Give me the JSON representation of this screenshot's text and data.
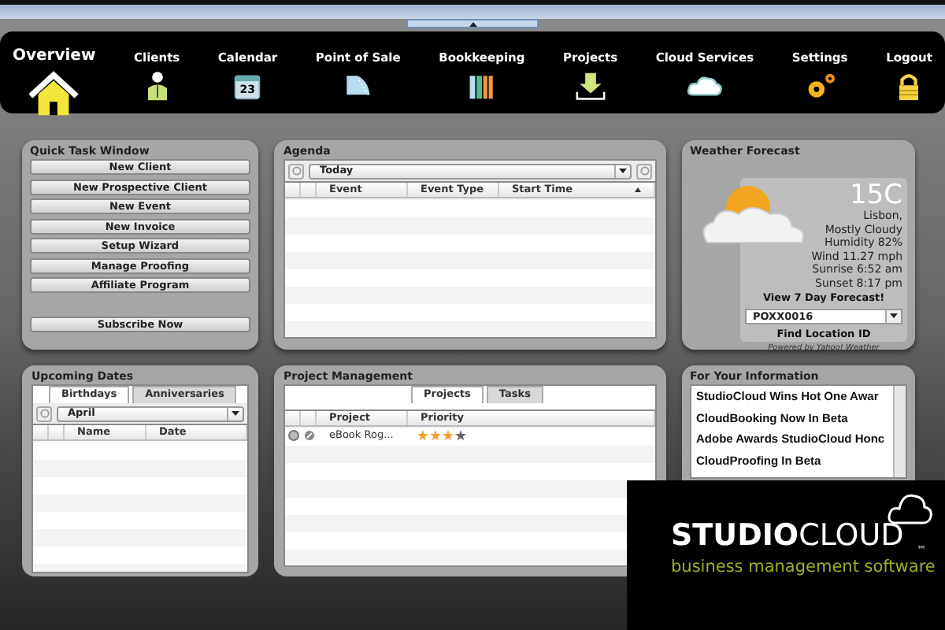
{
  "nav": [
    {
      "label": "Overview",
      "selected": true
    },
    {
      "label": "Clients",
      "selected": false
    },
    {
      "label": "Calendar",
      "selected": false
    },
    {
      "label": "Point of Sale",
      "selected": false
    },
    {
      "label": "Bookkeeping",
      "selected": false
    },
    {
      "label": "Projects",
      "selected": false
    },
    {
      "label": "Cloud Services",
      "selected": false
    },
    {
      "label": "Settings",
      "selected": false
    },
    {
      "label": "Logout",
      "selected": false
    }
  ],
  "calendar_day": "23",
  "quick_tasks": {
    "title": "Quick Task Window",
    "buttons": [
      "New Client",
      "New Prospective Client",
      "New Event",
      "New Invoice",
      "Setup Wizard",
      "Manage Proofing",
      "Affiliate Program"
    ],
    "subscribe": "Subscribe Now"
  },
  "agenda": {
    "title": "Agenda",
    "range": "Today",
    "columns": [
      "Event",
      "Event Type",
      "Start Time"
    ]
  },
  "weather": {
    "title": "Weather Forecast",
    "temperature": "15C",
    "lines": [
      "Lisbon,",
      "Mostly Cloudy",
      "Humidity 82%",
      "Wind 11.27 mph",
      "Sunrise 6:52 am",
      "Sunset 8:17 pm"
    ],
    "forecast_link": "View 7 Day Forecast!",
    "location": "POXX0016",
    "find_link": "Find Location ID",
    "credit": "Powered by Yahoo! Weather"
  },
  "upcoming": {
    "title": "Upcoming Dates",
    "tabs": [
      {
        "label": "Birthdays",
        "selected": true
      },
      {
        "label": "Anniversaries",
        "selected": false
      }
    ],
    "month": "April",
    "columns": [
      "Name",
      "Date"
    ]
  },
  "projects": {
    "title": "Project Management",
    "tabs": [
      {
        "label": "Projects",
        "selected": true
      },
      {
        "label": "Tasks",
        "selected": false
      }
    ],
    "columns": [
      "Project",
      "Priority"
    ],
    "rows": [
      {
        "project": "eBook Rog...",
        "stars": 3
      }
    ]
  },
  "info": {
    "title": "For Your Information",
    "items": [
      "StudioCloud Wins Hot One Awar",
      "CloudBooking Now In Beta",
      "Adobe Awards StudioCloud Honc",
      "CloudProofing In Beta"
    ]
  },
  "logo": {
    "brand_bold": "STUDIO",
    "brand_light": "CLOUD",
    "tm": "™",
    "tagline": "business management software"
  }
}
